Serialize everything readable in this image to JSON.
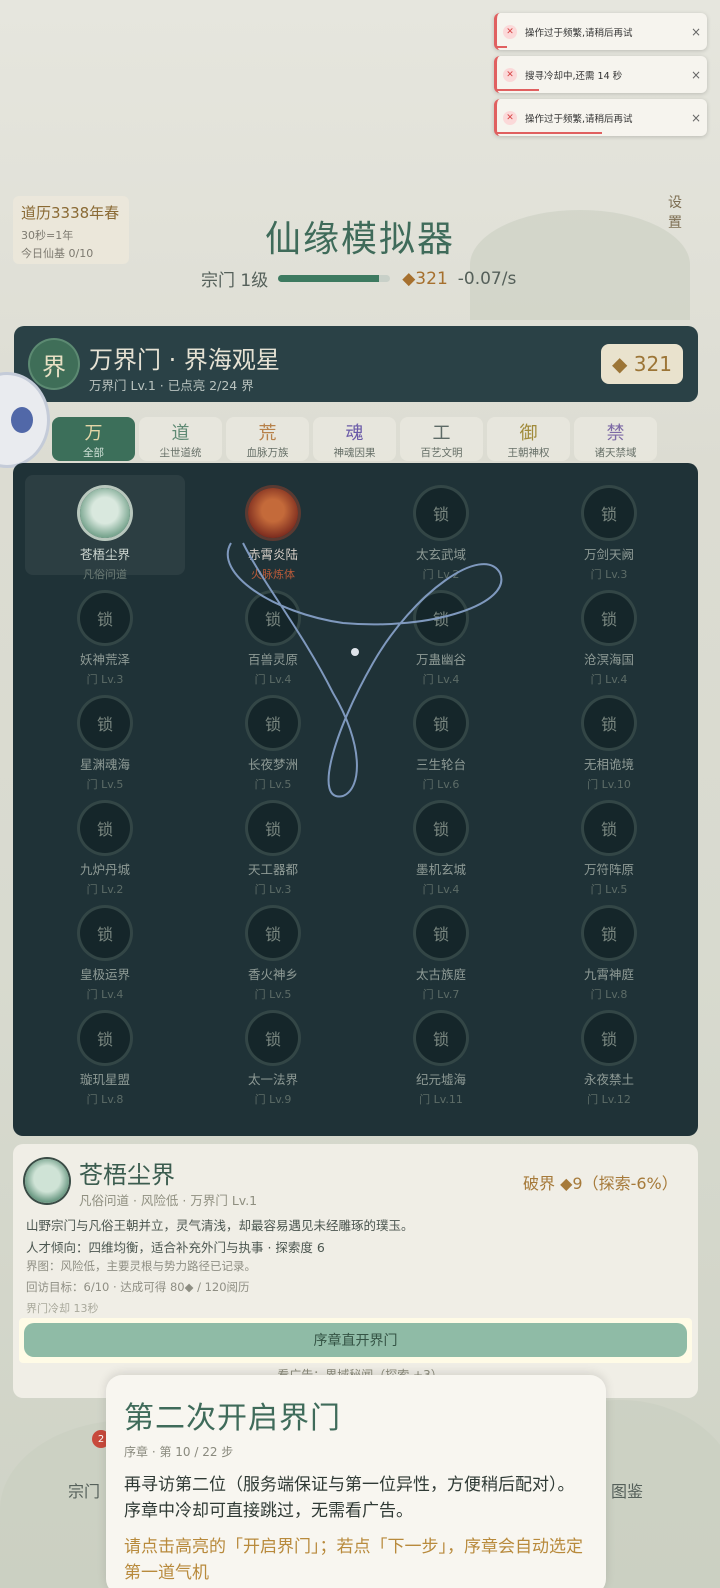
{
  "toasts": [
    {
      "icon": "close-circle-icon",
      "text": "操作过于频繁,请稍后再试",
      "close": "×",
      "progress": 0.05
    },
    {
      "icon": "close-circle-icon",
      "text": "搜寻冷却中,还需 14 秒",
      "close": "×",
      "progress": 0.2
    },
    {
      "icon": "close-circle-icon",
      "text": "操作过于频繁,请稍后再试",
      "close": "×",
      "progress": 0.5
    }
  ],
  "era": {
    "date": "道历3338年春",
    "rate": "30秒=1年",
    "foundation": "今日仙基 0/10"
  },
  "settings_label": "设\n置",
  "app_title": "仙缘模拟器",
  "sect": {
    "label": "宗门 1级",
    "progress": 0.9,
    "spirit": "◆321",
    "rate": "-0.07/s"
  },
  "realm_panel": {
    "glyph": "界",
    "title": "万界门 · 界海观星",
    "subtitle": "万界门 Lv.1 · 已点亮 2/24 界",
    "badge": "◆ 321"
  },
  "tabs": [
    {
      "glyph": "万",
      "label": "全部",
      "color": "#e4d6a8"
    },
    {
      "glyph": "道",
      "label": "尘世道统",
      "color": "#5f8a74"
    },
    {
      "glyph": "荒",
      "label": "血脉万族",
      "color": "#b7814a"
    },
    {
      "glyph": "魂",
      "label": "神魂因果",
      "color": "#6a5aa8"
    },
    {
      "glyph": "工",
      "label": "百艺文明",
      "color": "#5d6a66"
    },
    {
      "glyph": "御",
      "label": "王朝神权",
      "color": "#a08a3a"
    },
    {
      "glyph": "禁",
      "label": "诸天禁域",
      "color": "#7d6aa6"
    }
  ],
  "realms": [
    {
      "name": "苍梧尘界",
      "level": "凡俗问道",
      "orb": "",
      "selected": true
    },
    {
      "name": "赤霄炎陆",
      "level": "火脉炼体",
      "orb": "",
      "lit": true
    },
    {
      "name": "太玄武域",
      "level": "门 Lv.2",
      "orb": "锁"
    },
    {
      "name": "万剑天阙",
      "level": "门 Lv.3",
      "orb": "锁"
    },
    {
      "name": "妖神荒泽",
      "level": "门 Lv.3",
      "orb": "锁"
    },
    {
      "name": "百兽灵原",
      "level": "门 Lv.4",
      "orb": "锁"
    },
    {
      "name": "万蛊幽谷",
      "level": "门 Lv.4",
      "orb": "锁"
    },
    {
      "name": "沧溟海国",
      "level": "门 Lv.4",
      "orb": "锁"
    },
    {
      "name": "星渊魂海",
      "level": "门 Lv.5",
      "orb": "锁"
    },
    {
      "name": "长夜梦洲",
      "level": "门 Lv.5",
      "orb": "锁"
    },
    {
      "name": "三生轮台",
      "level": "门 Lv.6",
      "orb": "锁"
    },
    {
      "name": "无相诡境",
      "level": "门 Lv.10",
      "orb": "锁"
    },
    {
      "name": "九炉丹城",
      "level": "门 Lv.2",
      "orb": "锁"
    },
    {
      "name": "天工器都",
      "level": "门 Lv.3",
      "orb": "锁"
    },
    {
      "name": "墨机玄城",
      "level": "门 Lv.4",
      "orb": "锁"
    },
    {
      "name": "万符阵原",
      "level": "门 Lv.5",
      "orb": "锁"
    },
    {
      "name": "皇极运界",
      "level": "门 Lv.4",
      "orb": "锁"
    },
    {
      "name": "香火神乡",
      "level": "门 Lv.5",
      "orb": "锁"
    },
    {
      "name": "太古族庭",
      "level": "门 Lv.7",
      "orb": "锁"
    },
    {
      "name": "九霄神庭",
      "level": "门 Lv.8",
      "orb": "锁"
    },
    {
      "name": "璇玑星盟",
      "level": "门 Lv.8",
      "orb": "锁"
    },
    {
      "name": "太一法界",
      "level": "门 Lv.9",
      "orb": "锁"
    },
    {
      "name": "纪元墟海",
      "level": "门 Lv.11",
      "orb": "锁"
    },
    {
      "name": "永夜禁土",
      "level": "门 Lv.12",
      "orb": "锁"
    }
  ],
  "detail": {
    "name": "苍梧尘界",
    "meta": "凡俗问道 · 风险低 · 万界门 Lv.1",
    "cost": "破界 ◆9（探索-6%）",
    "desc": "山野宗门与凡俗王朝并立，灵气清浅，却最容易遇见未经雕琢的璞玉。",
    "talent": "人才倾向：四维均衡，适合补充外门与执事 · 探索度 6",
    "map": "界图：风险低，主要灵根与势力路径已记录。",
    "revisit": "回访目标：6/10 · 达成可得 80◆ / 120阅历",
    "cooldown": "界门冷却 13秒",
    "open_button": "序章直开界门",
    "ad_line": "看广告：界域秘闻（探索 +3）"
  },
  "nav": {
    "sect": "宗门",
    "codex": "图鉴",
    "badge": "2"
  },
  "tutorial": {
    "title": "第二次开启界门",
    "step": "序章 · 第 10 / 22 步",
    "body": "再寻访第二位（服务端保证与第一位异性，方便稍后配对）。序章中冷却可直接跳过，无需看广告。",
    "hint": "请点击高亮的「开启界门」；若点「下一步」，序章会自动选定第一道气机"
  }
}
